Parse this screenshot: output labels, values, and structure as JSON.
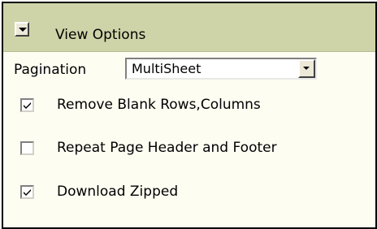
{
  "panel": {
    "title": "View Options",
    "icons": {
      "collapse": "chevron-down-icon",
      "dropdown": "chevron-down-icon",
      "check": "check-icon"
    }
  },
  "pagination": {
    "label": "Pagination",
    "selected": "MultiSheet"
  },
  "options": [
    {
      "label": "Remove Blank Rows,Columns",
      "checked": true
    },
    {
      "label": "Repeat Page Header and Footer",
      "checked": false
    },
    {
      "label": "Download Zipped",
      "checked": true
    }
  ],
  "colors": {
    "header_bg": "#cfd3a8",
    "panel_bg": "#fdfdf2",
    "border": "#000000"
  }
}
